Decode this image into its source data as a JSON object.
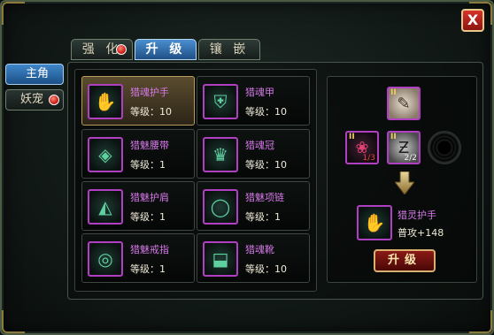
{
  "window": {
    "close_label": "X"
  },
  "tabs": [
    {
      "label": "强 化",
      "active": false,
      "has_alert": true
    },
    {
      "label": "升 级",
      "active": true,
      "has_alert": false
    },
    {
      "label": "镶 嵌",
      "active": false,
      "has_alert": false
    }
  ],
  "side": [
    {
      "label": "主角",
      "active": true,
      "has_alert": false
    },
    {
      "label": "妖宠",
      "active": false,
      "has_alert": true
    }
  ],
  "equipment": [
    {
      "name": "猎魂护手",
      "level": "等级：10",
      "icon": "gauntlet-icon",
      "selected": true
    },
    {
      "name": "猎魂甲",
      "level": "等级：10",
      "icon": "armor-icon",
      "selected": false
    },
    {
      "name": "猎魅腰带",
      "level": "等级：1",
      "icon": "belt-icon",
      "selected": false
    },
    {
      "name": "猎魂冠",
      "level": "等级：10",
      "icon": "crown-icon",
      "selected": false
    },
    {
      "name": "猎魅护肩",
      "level": "等级：1",
      "icon": "shoulder-icon",
      "selected": false
    },
    {
      "name": "猎魅项链",
      "level": "等级：1",
      "icon": "necklace-icon",
      "selected": false
    },
    {
      "name": "猎魅戒指",
      "level": "等级：1",
      "icon": "ring-icon",
      "selected": false
    },
    {
      "name": "猎魂靴",
      "level": "等级：10",
      "icon": "boots-icon",
      "selected": false
    }
  ],
  "upgrade": {
    "target_material": {
      "tier": "II",
      "icon": "scroll-icon"
    },
    "materials": [
      {
        "tier": "II",
        "count": "1/3",
        "icon": "gem-icon",
        "enough": false
      },
      {
        "tier": "II",
        "count": "2/2",
        "icon": "stone-icon",
        "enough": true
      }
    ],
    "result": {
      "name": "猎灵护手",
      "stat": "普攻+148",
      "icon": "gauntlet-icon"
    },
    "button_label": "升级"
  },
  "colors": {
    "item_name": "#d678e8",
    "accent_blue": "#3f87c9",
    "button_red": "#8a1a16"
  }
}
